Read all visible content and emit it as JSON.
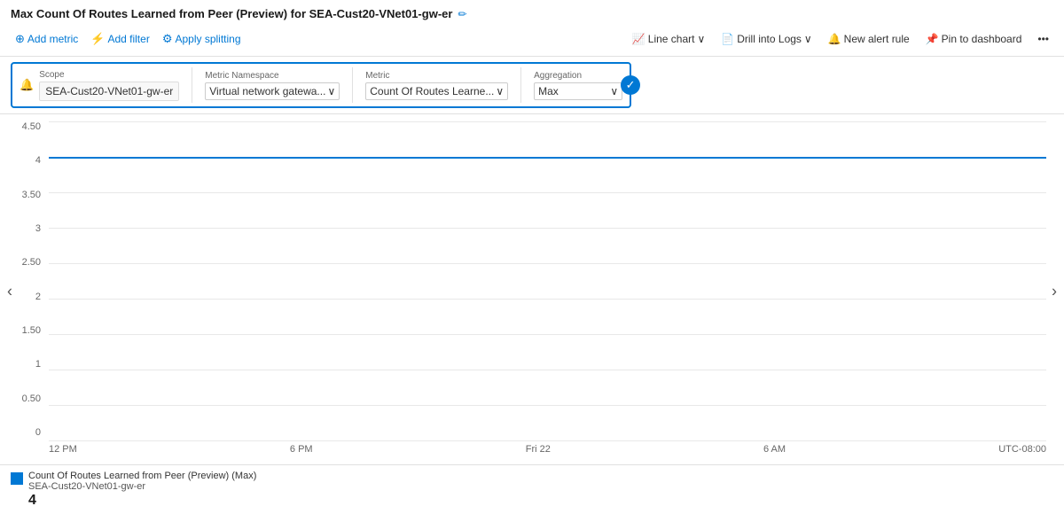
{
  "header": {
    "title": "Max Count Of Routes Learned from Peer (Preview) for SEA-Cust20-VNet01-gw-er",
    "edit_icon": "✏"
  },
  "toolbar": {
    "left": [
      {
        "id": "add-metric",
        "icon": "⊕",
        "label": "Add metric"
      },
      {
        "id": "add-filter",
        "icon": "⚡",
        "label": "Add filter"
      },
      {
        "id": "apply-splitting",
        "icon": "⚙",
        "label": "Apply splitting"
      }
    ],
    "right": [
      {
        "id": "line-chart",
        "icon": "📈",
        "label": "Line chart",
        "has_dropdown": true
      },
      {
        "id": "drill-into-logs",
        "icon": "📄",
        "label": "Drill into Logs",
        "has_dropdown": true
      },
      {
        "id": "new-alert-rule",
        "icon": "🔔",
        "label": "New alert rule"
      },
      {
        "id": "pin-to-dashboard",
        "icon": "📌",
        "label": "Pin to dashboard"
      },
      {
        "id": "more-options",
        "icon": "…",
        "label": ""
      }
    ]
  },
  "filter": {
    "scope_label": "Scope",
    "scope_value": "SEA-Cust20-VNet01-gw-er",
    "namespace_label": "Metric Namespace",
    "namespace_value": "Virtual network gatewa...",
    "metric_label": "Metric",
    "metric_value": "Count Of Routes Learne...",
    "aggregation_label": "Aggregation",
    "aggregation_value": "Max"
  },
  "chart": {
    "y_labels": [
      "4.50",
      "4",
      "3.50",
      "3",
      "2.50",
      "2",
      "1.50",
      "1",
      "0.50",
      "0"
    ],
    "y_positions": [
      0,
      11,
      22,
      33,
      44,
      56,
      67,
      78,
      89,
      100
    ],
    "line_value_percent": 11,
    "x_labels": [
      "12 PM",
      "6 PM",
      "Fri 22",
      "6 AM",
      "UTC-08:00"
    ],
    "timezone": "UTC-08:00"
  },
  "legend": {
    "title": "Count Of Routes Learned from Peer (Preview) (Max)",
    "subtitle": "SEA-Cust20-VNet01-gw-er",
    "value": "4"
  }
}
